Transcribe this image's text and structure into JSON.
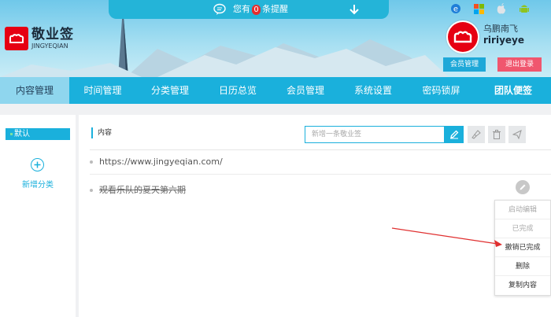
{
  "app": {
    "logo_cn": "敬业签",
    "logo_en": "JINGYEQIAN"
  },
  "notice": {
    "prefix": "您有",
    "count": "0",
    "suffix": "条提醒"
  },
  "user": {
    "name_cn": "乌鹏南飞",
    "name_en": "ririyeye",
    "member_label": "会员管理",
    "logout_label": "退出登录"
  },
  "nav": [
    "内容管理",
    "时间管理",
    "分类管理",
    "日历总览",
    "会员管理",
    "系统设置",
    "密码锁屏",
    "团队便签"
  ],
  "sidebar": {
    "default_label": "默认",
    "add_label": "新增分类"
  },
  "main": {
    "title": "内容",
    "input_placeholder": "新增一条敬业签",
    "items": [
      "https://www.jingyeqian.com/",
      "观看乐队的夏天第六期"
    ]
  },
  "context_menu": [
    "启动编辑",
    "已完成",
    "撤销已完成",
    "删除",
    "复制内容"
  ],
  "colors": {
    "accent": "#1ab0dc",
    "logo_red": "#e60012",
    "logout": "#f0566e"
  },
  "icons": [
    "chat-bubble-icon",
    "arrow-down-icon",
    "ie-icon",
    "windows-icon",
    "apple-icon",
    "android-icon",
    "cloud-icon",
    "plus-icon",
    "pencil-icon",
    "broom-icon",
    "trash-icon",
    "send-icon"
  ]
}
